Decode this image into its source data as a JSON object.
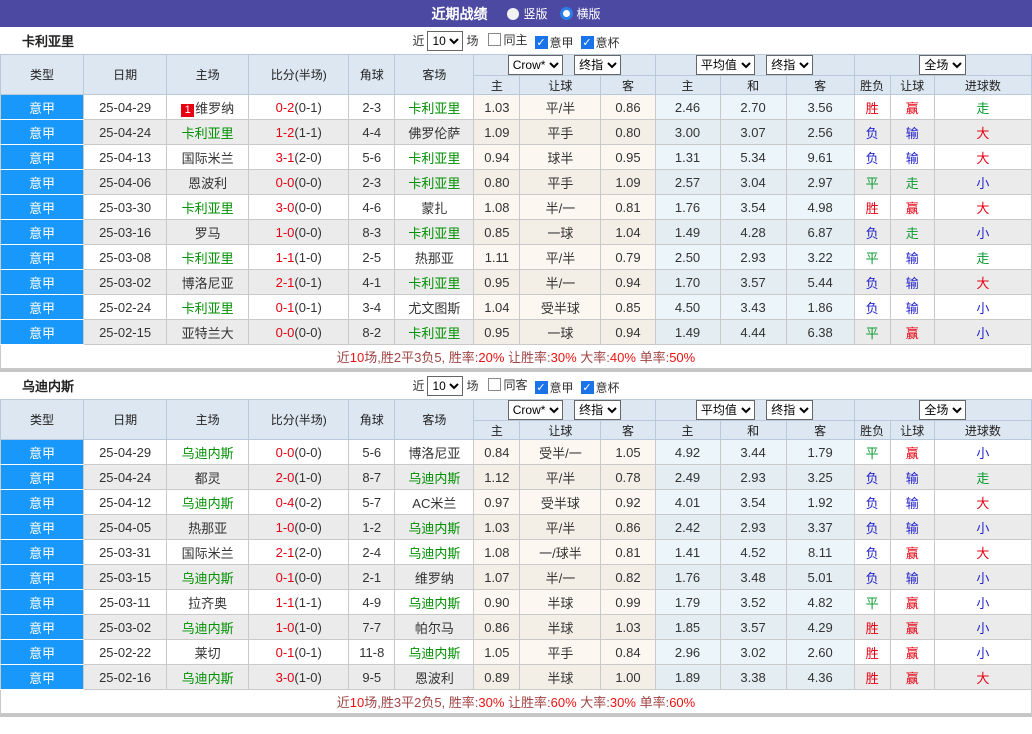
{
  "topbar": {
    "title": "近期战绩",
    "radios": [
      {
        "label": "竖版",
        "checked": false
      },
      {
        "label": "横版",
        "checked": true
      }
    ]
  },
  "colors": {
    "topbar_purple": "#4c49a2",
    "league_cell_blue": "#1898fa",
    "focus_team_green": "#009000",
    "score_red": "#e60012",
    "result_win_red": "#e60012",
    "result_lose_blue": "#2323cc",
    "result_draw_green": "#0a9b31",
    "header_bg": "#dde7f1",
    "odds_col_bg": "#fcf8f1",
    "avg_col_bg": "#ecf6fa",
    "even_row_bg": "#ebebeb"
  },
  "table_header": {
    "left_cols": [
      "类型",
      "日期",
      "主场",
      "比分(半场)",
      "角球",
      "客场"
    ],
    "selects": [
      "Crow*",
      "终指",
      "平均值",
      "终指",
      "全场"
    ],
    "sub_cols": [
      "主",
      "让球",
      "客",
      "主",
      "和",
      "客",
      "胜负",
      "让球",
      "进球数"
    ]
  },
  "sections": [
    {
      "team": "卡利亚里",
      "controls": {
        "near_label": "近",
        "count": "10",
        "unit": "场",
        "checkboxes": [
          {
            "label": "同主",
            "checked": false
          },
          {
            "label": "意甲",
            "checked": true
          },
          {
            "label": "意杯",
            "checked": true
          }
        ]
      },
      "rows": [
        {
          "league": "意甲",
          "date": "25-04-29",
          "home": "维罗纳",
          "home_focus": false,
          "rank": "1",
          "score": "0-2",
          "half": "(0-1)",
          "corner": "2-3",
          "away": "卡利亚里",
          "away_focus": true,
          "odds": [
            "1.03",
            "平/半",
            "0.86"
          ],
          "avg": [
            "2.46",
            "2.70",
            "3.56"
          ],
          "res": [
            {
              "t": "胜",
              "c": "red"
            },
            {
              "t": "赢",
              "c": "red"
            },
            {
              "t": "走",
              "c": "green"
            }
          ]
        },
        {
          "league": "意甲",
          "date": "25-04-24",
          "home": "卡利亚里",
          "home_focus": true,
          "rank": "",
          "score": "1-2",
          "half": "(1-1)",
          "corner": "4-4",
          "away": "佛罗伦萨",
          "away_focus": false,
          "odds": [
            "1.09",
            "平手",
            "0.80"
          ],
          "avg": [
            "3.00",
            "3.07",
            "2.56"
          ],
          "res": [
            {
              "t": "负",
              "c": "blue"
            },
            {
              "t": "输",
              "c": "blue"
            },
            {
              "t": "大",
              "c": "red"
            }
          ]
        },
        {
          "league": "意甲",
          "date": "25-04-13",
          "home": "国际米兰",
          "home_focus": false,
          "rank": "",
          "score": "3-1",
          "half": "(2-0)",
          "corner": "5-6",
          "away": "卡利亚里",
          "away_focus": true,
          "odds": [
            "0.94",
            "球半",
            "0.95"
          ],
          "avg": [
            "1.31",
            "5.34",
            "9.61"
          ],
          "res": [
            {
              "t": "负",
              "c": "blue"
            },
            {
              "t": "输",
              "c": "blue"
            },
            {
              "t": "大",
              "c": "red"
            }
          ]
        },
        {
          "league": "意甲",
          "date": "25-04-06",
          "home": "恩波利",
          "home_focus": false,
          "rank": "",
          "score": "0-0",
          "half": "(0-0)",
          "corner": "2-3",
          "away": "卡利亚里",
          "away_focus": true,
          "odds": [
            "0.80",
            "平手",
            "1.09"
          ],
          "avg": [
            "2.57",
            "3.04",
            "2.97"
          ],
          "res": [
            {
              "t": "平",
              "c": "green"
            },
            {
              "t": "走",
              "c": "green"
            },
            {
              "t": "小",
              "c": "blue"
            }
          ]
        },
        {
          "league": "意甲",
          "date": "25-03-30",
          "home": "卡利亚里",
          "home_focus": true,
          "rank": "",
          "score": "3-0",
          "half": "(0-0)",
          "corner": "4-6",
          "away": "蒙扎",
          "away_focus": false,
          "odds": [
            "1.08",
            "半/一",
            "0.81"
          ],
          "avg": [
            "1.76",
            "3.54",
            "4.98"
          ],
          "res": [
            {
              "t": "胜",
              "c": "red"
            },
            {
              "t": "赢",
              "c": "red"
            },
            {
              "t": "大",
              "c": "red"
            }
          ]
        },
        {
          "league": "意甲",
          "date": "25-03-16",
          "home": "罗马",
          "home_focus": false,
          "rank": "",
          "score": "1-0",
          "half": "(0-0)",
          "corner": "8-3",
          "away": "卡利亚里",
          "away_focus": true,
          "odds": [
            "0.85",
            "一球",
            "1.04"
          ],
          "avg": [
            "1.49",
            "4.28",
            "6.87"
          ],
          "res": [
            {
              "t": "负",
              "c": "blue"
            },
            {
              "t": "走",
              "c": "green"
            },
            {
              "t": "小",
              "c": "blue"
            }
          ]
        },
        {
          "league": "意甲",
          "date": "25-03-08",
          "home": "卡利亚里",
          "home_focus": true,
          "rank": "",
          "score": "1-1",
          "half": "(1-0)",
          "corner": "2-5",
          "away": "热那亚",
          "away_focus": false,
          "odds": [
            "1.11",
            "平/半",
            "0.79"
          ],
          "avg": [
            "2.50",
            "2.93",
            "3.22"
          ],
          "res": [
            {
              "t": "平",
              "c": "green"
            },
            {
              "t": "输",
              "c": "blue"
            },
            {
              "t": "走",
              "c": "green"
            }
          ]
        },
        {
          "league": "意甲",
          "date": "25-03-02",
          "home": "博洛尼亚",
          "home_focus": false,
          "rank": "",
          "score": "2-1",
          "half": "(0-1)",
          "corner": "4-1",
          "away": "卡利亚里",
          "away_focus": true,
          "odds": [
            "0.95",
            "半/一",
            "0.94"
          ],
          "avg": [
            "1.70",
            "3.57",
            "5.44"
          ],
          "res": [
            {
              "t": "负",
              "c": "blue"
            },
            {
              "t": "输",
              "c": "blue"
            },
            {
              "t": "大",
              "c": "red"
            }
          ]
        },
        {
          "league": "意甲",
          "date": "25-02-24",
          "home": "卡利亚里",
          "home_focus": true,
          "rank": "",
          "score": "0-1",
          "half": "(0-1)",
          "corner": "3-4",
          "away": "尤文图斯",
          "away_focus": false,
          "odds": [
            "1.04",
            "受半球",
            "0.85"
          ],
          "avg": [
            "4.50",
            "3.43",
            "1.86"
          ],
          "res": [
            {
              "t": "负",
              "c": "blue"
            },
            {
              "t": "输",
              "c": "blue"
            },
            {
              "t": "小",
              "c": "blue"
            }
          ]
        },
        {
          "league": "意甲",
          "date": "25-02-15",
          "home": "亚特兰大",
          "home_focus": false,
          "rank": "",
          "score": "0-0",
          "half": "(0-0)",
          "corner": "8-2",
          "away": "卡利亚里",
          "away_focus": true,
          "odds": [
            "0.95",
            "一球",
            "0.94"
          ],
          "avg": [
            "1.49",
            "4.44",
            "6.38"
          ],
          "res": [
            {
              "t": "平",
              "c": "green"
            },
            {
              "t": "赢",
              "c": "red"
            },
            {
              "t": "小",
              "c": "blue"
            }
          ]
        }
      ],
      "summary": {
        "segments": [
          {
            "t": "近"
          },
          {
            "t": "10",
            "red": true
          },
          {
            "t": "场,胜2平3负5, 胜率:"
          },
          {
            "t": "20%",
            "red": true
          },
          {
            "t": " 让胜率:"
          },
          {
            "t": "30%",
            "red": true
          },
          {
            "t": " 大率:"
          },
          {
            "t": "40%",
            "red": true
          },
          {
            "t": " 单率:"
          },
          {
            "t": "50%",
            "red": true
          }
        ]
      }
    },
    {
      "team": "乌迪内斯",
      "controls": {
        "near_label": "近",
        "count": "10",
        "unit": "场",
        "checkboxes": [
          {
            "label": "同客",
            "checked": false
          },
          {
            "label": "意甲",
            "checked": true
          },
          {
            "label": "意杯",
            "checked": true
          }
        ]
      },
      "rows": [
        {
          "league": "意甲",
          "date": "25-04-29",
          "home": "乌迪内斯",
          "home_focus": true,
          "rank": "",
          "score": "0-0",
          "half": "(0-0)",
          "corner": "5-6",
          "away": "博洛尼亚",
          "away_focus": false,
          "odds": [
            "0.84",
            "受半/一",
            "1.05"
          ],
          "avg": [
            "4.92",
            "3.44",
            "1.79"
          ],
          "res": [
            {
              "t": "平",
              "c": "green"
            },
            {
              "t": "赢",
              "c": "red"
            },
            {
              "t": "小",
              "c": "blue"
            }
          ]
        },
        {
          "league": "意甲",
          "date": "25-04-24",
          "home": "都灵",
          "home_focus": false,
          "rank": "",
          "score": "2-0",
          "half": "(1-0)",
          "corner": "8-7",
          "away": "乌迪内斯",
          "away_focus": true,
          "odds": [
            "1.12",
            "平/半",
            "0.78"
          ],
          "avg": [
            "2.49",
            "2.93",
            "3.25"
          ],
          "res": [
            {
              "t": "负",
              "c": "blue"
            },
            {
              "t": "输",
              "c": "blue"
            },
            {
              "t": "走",
              "c": "green"
            }
          ]
        },
        {
          "league": "意甲",
          "date": "25-04-12",
          "home": "乌迪内斯",
          "home_focus": true,
          "rank": "",
          "score": "0-4",
          "half": "(0-2)",
          "corner": "5-7",
          "away": "AC米兰",
          "away_focus": false,
          "odds": [
            "0.97",
            "受半球",
            "0.92"
          ],
          "avg": [
            "4.01",
            "3.54",
            "1.92"
          ],
          "res": [
            {
              "t": "负",
              "c": "blue"
            },
            {
              "t": "输",
              "c": "blue"
            },
            {
              "t": "大",
              "c": "red"
            }
          ]
        },
        {
          "league": "意甲",
          "date": "25-04-05",
          "home": "热那亚",
          "home_focus": false,
          "rank": "",
          "score": "1-0",
          "half": "(0-0)",
          "corner": "1-2",
          "away": "乌迪内斯",
          "away_focus": true,
          "odds": [
            "1.03",
            "平/半",
            "0.86"
          ],
          "avg": [
            "2.42",
            "2.93",
            "3.37"
          ],
          "res": [
            {
              "t": "负",
              "c": "blue"
            },
            {
              "t": "输",
              "c": "blue"
            },
            {
              "t": "小",
              "c": "blue"
            }
          ]
        },
        {
          "league": "意甲",
          "date": "25-03-31",
          "home": "国际米兰",
          "home_focus": false,
          "rank": "",
          "score": "2-1",
          "half": "(2-0)",
          "corner": "2-4",
          "away": "乌迪内斯",
          "away_focus": true,
          "odds": [
            "1.08",
            "一/球半",
            "0.81"
          ],
          "avg": [
            "1.41",
            "4.52",
            "8.11"
          ],
          "res": [
            {
              "t": "负",
              "c": "blue"
            },
            {
              "t": "赢",
              "c": "red"
            },
            {
              "t": "大",
              "c": "red"
            }
          ]
        },
        {
          "league": "意甲",
          "date": "25-03-15",
          "home": "乌迪内斯",
          "home_focus": true,
          "rank": "",
          "score": "0-1",
          "half": "(0-0)",
          "corner": "2-1",
          "away": "维罗纳",
          "away_focus": false,
          "odds": [
            "1.07",
            "半/一",
            "0.82"
          ],
          "avg": [
            "1.76",
            "3.48",
            "5.01"
          ],
          "res": [
            {
              "t": "负",
              "c": "blue"
            },
            {
              "t": "输",
              "c": "blue"
            },
            {
              "t": "小",
              "c": "blue"
            }
          ]
        },
        {
          "league": "意甲",
          "date": "25-03-11",
          "home": "拉齐奥",
          "home_focus": false,
          "rank": "",
          "score": "1-1",
          "half": "(1-1)",
          "corner": "4-9",
          "away": "乌迪内斯",
          "away_focus": true,
          "odds": [
            "0.90",
            "半球",
            "0.99"
          ],
          "avg": [
            "1.79",
            "3.52",
            "4.82"
          ],
          "res": [
            {
              "t": "平",
              "c": "green"
            },
            {
              "t": "赢",
              "c": "red"
            },
            {
              "t": "小",
              "c": "blue"
            }
          ]
        },
        {
          "league": "意甲",
          "date": "25-03-02",
          "home": "乌迪内斯",
          "home_focus": true,
          "rank": "",
          "score": "1-0",
          "half": "(1-0)",
          "corner": "7-7",
          "away": "帕尔马",
          "away_focus": false,
          "odds": [
            "0.86",
            "半球",
            "1.03"
          ],
          "avg": [
            "1.85",
            "3.57",
            "4.29"
          ],
          "res": [
            {
              "t": "胜",
              "c": "red"
            },
            {
              "t": "赢",
              "c": "red"
            },
            {
              "t": "小",
              "c": "blue"
            }
          ]
        },
        {
          "league": "意甲",
          "date": "25-02-22",
          "home": "莱切",
          "home_focus": false,
          "rank": "",
          "score": "0-1",
          "half": "(0-1)",
          "corner": "11-8",
          "away": "乌迪内斯",
          "away_focus": true,
          "odds": [
            "1.05",
            "平手",
            "0.84"
          ],
          "avg": [
            "2.96",
            "3.02",
            "2.60"
          ],
          "res": [
            {
              "t": "胜",
              "c": "red"
            },
            {
              "t": "赢",
              "c": "red"
            },
            {
              "t": "小",
              "c": "blue"
            }
          ]
        },
        {
          "league": "意甲",
          "date": "25-02-16",
          "home": "乌迪内斯",
          "home_focus": true,
          "rank": "",
          "score": "3-0",
          "half": "(1-0)",
          "corner": "9-5",
          "away": "恩波利",
          "away_focus": false,
          "odds": [
            "0.89",
            "半球",
            "1.00"
          ],
          "avg": [
            "1.89",
            "3.38",
            "4.36"
          ],
          "res": [
            {
              "t": "胜",
              "c": "red"
            },
            {
              "t": "赢",
              "c": "red"
            },
            {
              "t": "大",
              "c": "red"
            }
          ]
        }
      ],
      "summary": {
        "segments": [
          {
            "t": "近"
          },
          {
            "t": "10",
            "red": true
          },
          {
            "t": "场,胜3平2负5, 胜率:"
          },
          {
            "t": "30%",
            "red": true
          },
          {
            "t": " 让胜率:"
          },
          {
            "t": "60%",
            "red": true
          },
          {
            "t": " 大率:"
          },
          {
            "t": "30%",
            "red": true
          },
          {
            "t": " 单率:"
          },
          {
            "t": "60%",
            "red": true
          }
        ]
      }
    }
  ]
}
